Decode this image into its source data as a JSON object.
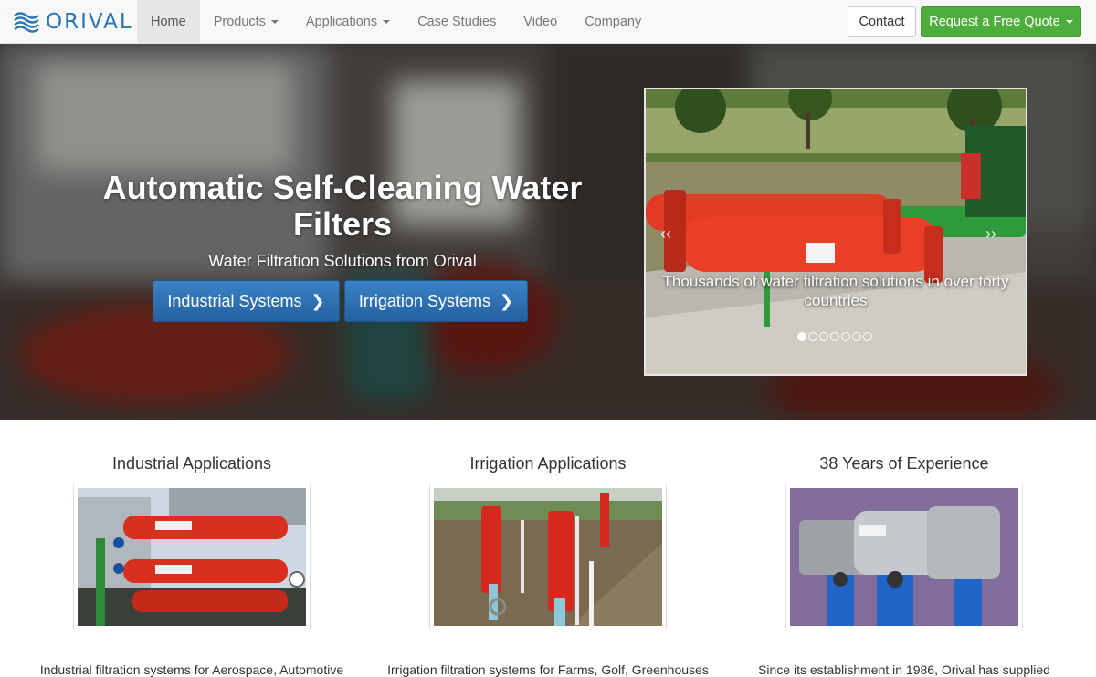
{
  "brand": {
    "name": "ORIVAL",
    "color": "#2a76b6"
  },
  "nav": {
    "items": [
      {
        "label": "Home",
        "active": true,
        "dropdown": false
      },
      {
        "label": "Products",
        "active": false,
        "dropdown": true
      },
      {
        "label": "Applications",
        "active": false,
        "dropdown": true
      },
      {
        "label": "Case Studies",
        "active": false,
        "dropdown": false
      },
      {
        "label": "Video",
        "active": false,
        "dropdown": false
      },
      {
        "label": "Company",
        "active": false,
        "dropdown": false
      }
    ],
    "contact_label": "Contact",
    "quote_label": "Request a Free Quote"
  },
  "hero": {
    "title": "Automatic Self-Cleaning Water Filters",
    "subtitle": "Water Filtration Solutions from Orival",
    "buttons": [
      {
        "label": "Industrial Systems",
        "icon": "chevron-right-icon"
      },
      {
        "label": "Irrigation Systems",
        "icon": "chevron-right-icon"
      }
    ],
    "carousel": {
      "caption": "Thousands of water filtration solutions in over forty countries",
      "slide_count": 7,
      "active_slide": 1
    }
  },
  "columns": [
    {
      "title": "Industrial Applications",
      "text": "Industrial filtration systems for Aerospace, Automotive"
    },
    {
      "title": "Irrigation Applications",
      "text": "Irrigation filtration systems for Farms, Golf, Greenhouses"
    },
    {
      "title": "38 Years of Experience",
      "text": "Since its establishment in 1986, Orival has supplied"
    }
  ],
  "colors": {
    "primary_button": "#2b6faf",
    "quote_button": "#4eae3c",
    "filter_red": "#d8301f"
  }
}
